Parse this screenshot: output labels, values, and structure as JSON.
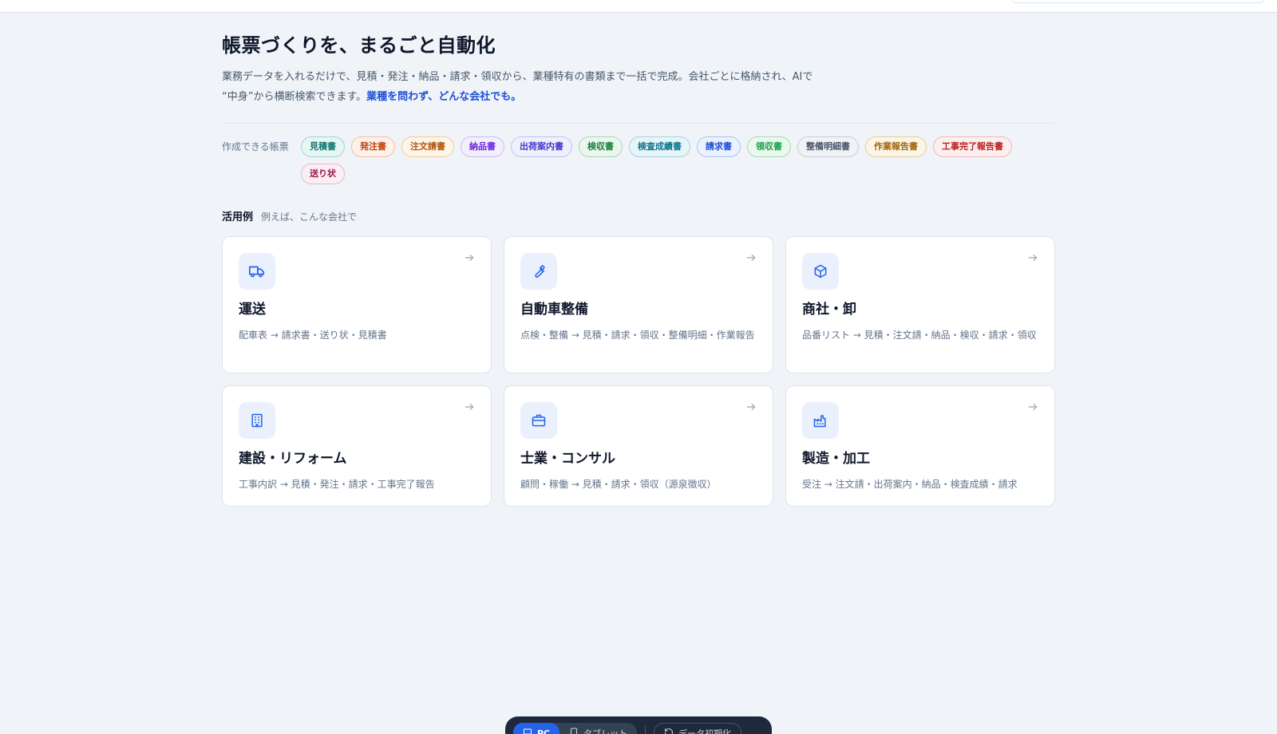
{
  "hero": {
    "title": "帳票づくりを、まるごと自動化",
    "desc_line1": "業務データを入れるだけで、見積・発注・納品・請求・領収から、業種特有の書類まで一括で完成。会社ごとに格納され、AIで",
    "desc_line2": "“中身”から横断検索できます。",
    "desc_highlight": "業種を問わず、どんな会社でも。"
  },
  "documents": {
    "label": "作成できる帳票",
    "items": [
      {
        "label": "見積書",
        "color": "#0f766e",
        "bg": "#e6f6f3",
        "border": "#9fd8cd"
      },
      {
        "label": "発注書",
        "color": "#c2410c",
        "bg": "#fdf1ea",
        "border": "#f0c1a6"
      },
      {
        "label": "注文請書",
        "color": "#b45309",
        "bg": "#fdf5e7",
        "border": "#efcf98"
      },
      {
        "label": "納品書",
        "color": "#6d28d9",
        "bg": "#f2eefc",
        "border": "#cdbdf0"
      },
      {
        "label": "出荷案内書",
        "color": "#4338ca",
        "bg": "#eef0fc",
        "border": "#bfc5ef"
      },
      {
        "label": "検収書",
        "color": "#15803d",
        "bg": "#eaf6ee",
        "border": "#a8d8b7"
      },
      {
        "label": "検査成績書",
        "color": "#0e7490",
        "bg": "#e8f5f8",
        "border": "#a4d3de"
      },
      {
        "label": "請求書",
        "color": "#1d4ed8",
        "bg": "#ebf1fd",
        "border": "#acc3f2"
      },
      {
        "label": "領収書",
        "color": "#16a34a",
        "bg": "#eaf8ee",
        "border": "#a6dcb6"
      },
      {
        "label": "整備明細書",
        "color": "#475569",
        "bg": "#f0f2f5",
        "border": "#c8cfd9"
      },
      {
        "label": "作業報告書",
        "color": "#a16207",
        "bg": "#fbf5e8",
        "border": "#e5cf9c"
      },
      {
        "label": "工事完了報告書",
        "color": "#b91c1c",
        "bg": "#fcefef",
        "border": "#eeb9b9"
      },
      {
        "label": "送り状",
        "color": "#9d174d",
        "bg": "#fbeff4",
        "border": "#e9b8cd"
      }
    ]
  },
  "usecases": {
    "title": "活用例",
    "subtitle": "例えば、こんな会社で",
    "cards": [
      {
        "icon": "truck-icon",
        "title": "運送",
        "desc": "配車表 → 請求書・送り状・見積書"
      },
      {
        "icon": "wrench-icon",
        "title": "自動車整備",
        "desc": "点検・整備 → 見積・請求・領収・整備明細・作業報告"
      },
      {
        "icon": "box-icon",
        "title": "商社・卸",
        "desc": "品番リスト → 見積・注文請・納品・検収・請求・領収"
      },
      {
        "icon": "building-icon",
        "title": "建設・リフォーム",
        "desc": "工事内訳 → 見積・発注・請求・工事完了報告"
      },
      {
        "icon": "briefcase-icon",
        "title": "士業・コンサル",
        "desc": "顧問・稼働 → 見積・請求・領収（源泉徴収）"
      },
      {
        "icon": "factory-icon",
        "title": "製造・加工",
        "desc": "受注 → 注文請・出荷案内・納品・検査成績・請求"
      }
    ]
  },
  "dock": {
    "pc_label": "PC",
    "tablet_label": "タブレット",
    "reset_label": "データ初期化"
  },
  "colors": {
    "accent": "#2563eb",
    "background": "#f0f4f9",
    "icon_blue": "#2563eb"
  }
}
